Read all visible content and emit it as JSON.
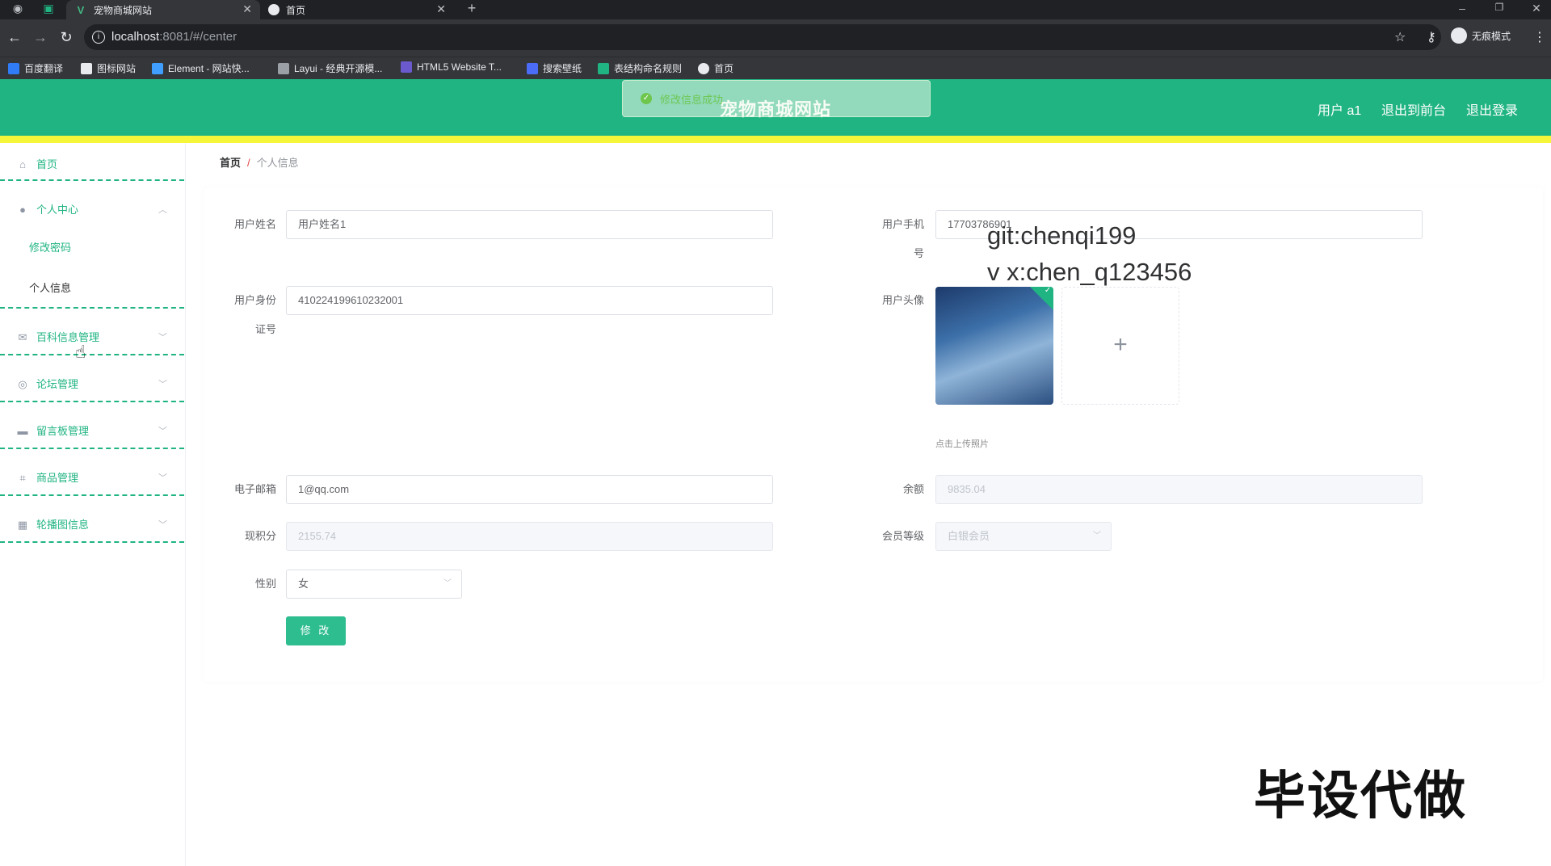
{
  "browser": {
    "tabs": [
      {
        "title": "宠物商城网站",
        "active": true
      },
      {
        "title": "首页",
        "active": false
      }
    ],
    "new_tab": "+",
    "url_host": "localhost",
    "url_path": ":8081/#/center",
    "profile_label": "无痕模式",
    "bookmarks": [
      {
        "label": "百度翻译",
        "color": "#2f7cf6"
      },
      {
        "label": "图标网站",
        "color": "#e8eaed"
      },
      {
        "label": "Element - 网站快...",
        "color": "#409eff"
      },
      {
        "label": "Layui - 经典开源模...",
        "color": "#9aa0a6"
      },
      {
        "label": "HTML5 Website T...",
        "color": "#6a5acd"
      },
      {
        "label": "搜索壁纸",
        "color": "#4a6cf7"
      },
      {
        "label": "表结构命名规则",
        "color": "#20b482"
      },
      {
        "label": "首页",
        "color": "#e8eaed"
      }
    ]
  },
  "header": {
    "site_title": "宠物商城网站",
    "toast": "修改信息成功",
    "user_label": "用户 a1",
    "front_link": "退出到前台",
    "logout_link": "退出登录",
    "color": "#20b482"
  },
  "sidebar": {
    "home": "首页",
    "personal_center": "个人中心",
    "change_password": "修改密码",
    "personal_info": "个人信息",
    "wiki_mgmt": "百科信息管理",
    "forum_mgmt": "论坛管理",
    "board_mgmt": "留言板管理",
    "goods_mgmt": "商品管理",
    "carousel_info": "轮播图信息"
  },
  "breadcrumb": {
    "home": "首页",
    "sep": "/",
    "current": "个人信息"
  },
  "form": {
    "name_label": "用户姓名",
    "name_value": "用户姓名1",
    "phone_label_1": "用户手机",
    "phone_label_2": "号",
    "phone_value": "17703786901",
    "id_label_1": "用户身份",
    "id_label_2": "证号",
    "id_value": "410224199610232001",
    "avatar_label": "用户头像",
    "upload_tip": "点击上传照片",
    "email_label": "电子邮箱",
    "email_value": "1@qq.com",
    "balance_label": "余额",
    "balance_value": "9835.04",
    "points_label": "现积分",
    "points_value": "2155.74",
    "level_label": "会员等级",
    "level_value": "白银会员",
    "gender_label": "性别",
    "gender_value": "女",
    "submit": "修 改"
  },
  "watermark": {
    "git": "git:chenqi199",
    "vx": "v x:chen_q123456",
    "big": "毕设代做"
  }
}
